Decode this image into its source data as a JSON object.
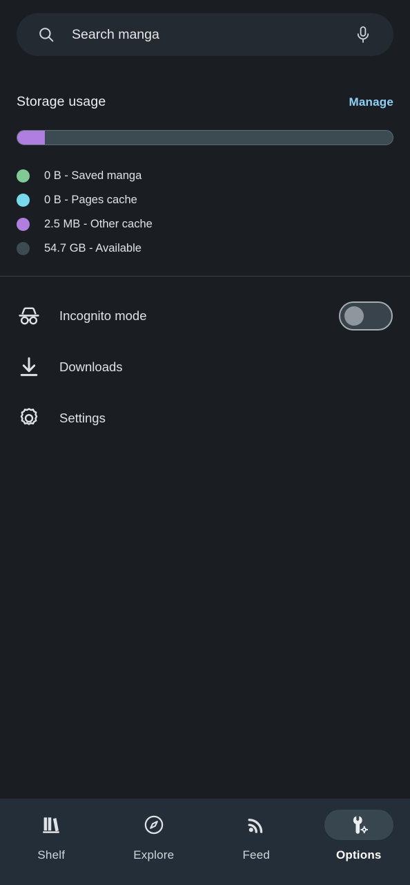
{
  "search": {
    "placeholder": "Search manga",
    "value": "",
    "search_icon": "search-icon",
    "mic_icon": "microphone-icon"
  },
  "storage": {
    "title": "Storage usage",
    "manage_label": "Manage",
    "manage_color": "#8ed0f5",
    "bar": {
      "track_color": "#3c4a52",
      "segments": [
        {
          "name": "Other cache",
          "color": "#b07ee0",
          "percent": 7.3
        }
      ]
    },
    "legend": [
      {
        "label": "0 B - Saved manga",
        "color": "#81c995"
      },
      {
        "label": "0 B - Pages cache",
        "color": "#78d9ec"
      },
      {
        "label": "2.5 MB - Other cache",
        "color": "#b07ee0"
      },
      {
        "label": "54.7 GB - Available",
        "color": "#3c4a52"
      }
    ]
  },
  "menu": [
    {
      "label": "Incognito mode",
      "icon": "incognito-icon",
      "toggle": {
        "state": "off"
      }
    },
    {
      "label": "Downloads",
      "icon": "download-icon"
    },
    {
      "label": "Settings",
      "icon": "gear-icon"
    }
  ],
  "bottom_nav": {
    "active_index": 3,
    "items": [
      {
        "label": "Shelf",
        "icon": "books-icon"
      },
      {
        "label": "Explore",
        "icon": "compass-icon"
      },
      {
        "label": "Feed",
        "icon": "rss-icon"
      },
      {
        "label": "Options",
        "icon": "wrench-gear-icon"
      }
    ]
  }
}
